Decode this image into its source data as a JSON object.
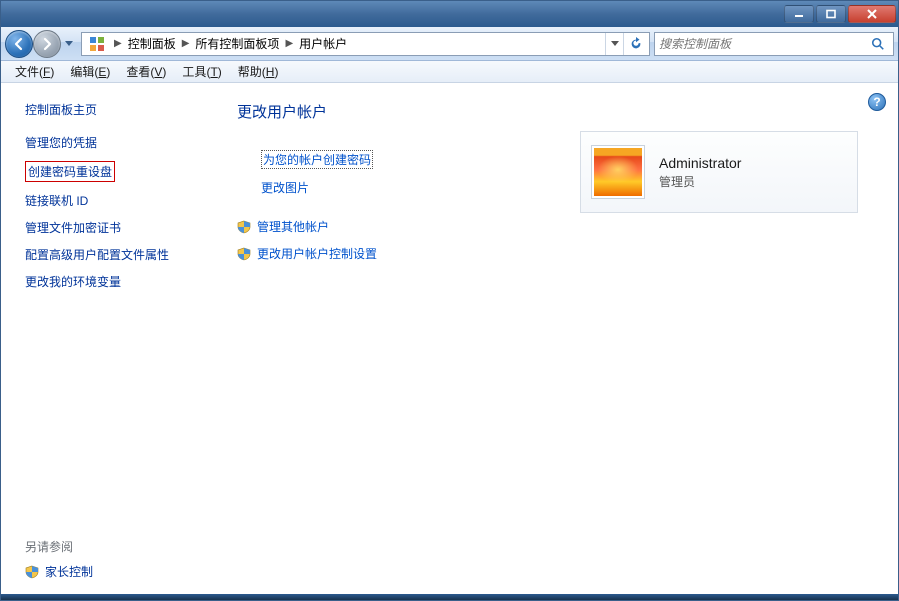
{
  "titlebar": {
    "title": ""
  },
  "nav": {
    "breadcrumbs": [
      "控制面板",
      "所有控制面板项",
      "用户帐户"
    ],
    "search_placeholder": "搜索控制面板"
  },
  "menubar": {
    "items": [
      {
        "label": "文件",
        "key": "F"
      },
      {
        "label": "编辑",
        "key": "E"
      },
      {
        "label": "查看",
        "key": "V"
      },
      {
        "label": "工具",
        "key": "T"
      },
      {
        "label": "帮助",
        "key": "H"
      }
    ]
  },
  "sidebar": {
    "home": "控制面板主页",
    "links": [
      {
        "label": "管理您的凭据",
        "highlight": false
      },
      {
        "label": "创建密码重设盘",
        "highlight": true
      },
      {
        "label": "链接联机 ID",
        "highlight": false
      },
      {
        "label": "管理文件加密证书",
        "highlight": false
      },
      {
        "label": "配置高级用户配置文件属性",
        "highlight": false
      },
      {
        "label": "更改我的环境变量",
        "highlight": false
      }
    ],
    "see_also_title": "另请参阅",
    "see_also": [
      {
        "label": "家长控制",
        "shield": true
      }
    ]
  },
  "main": {
    "title": "更改用户帐户",
    "actions": [
      {
        "label": "为您的帐户创建密码",
        "selected": true
      },
      {
        "label": "更改图片",
        "selected": false
      }
    ],
    "shield_actions": [
      {
        "label": "管理其他帐户"
      },
      {
        "label": "更改用户帐户控制设置"
      }
    ]
  },
  "account": {
    "name": "Administrator",
    "role": "管理员"
  }
}
